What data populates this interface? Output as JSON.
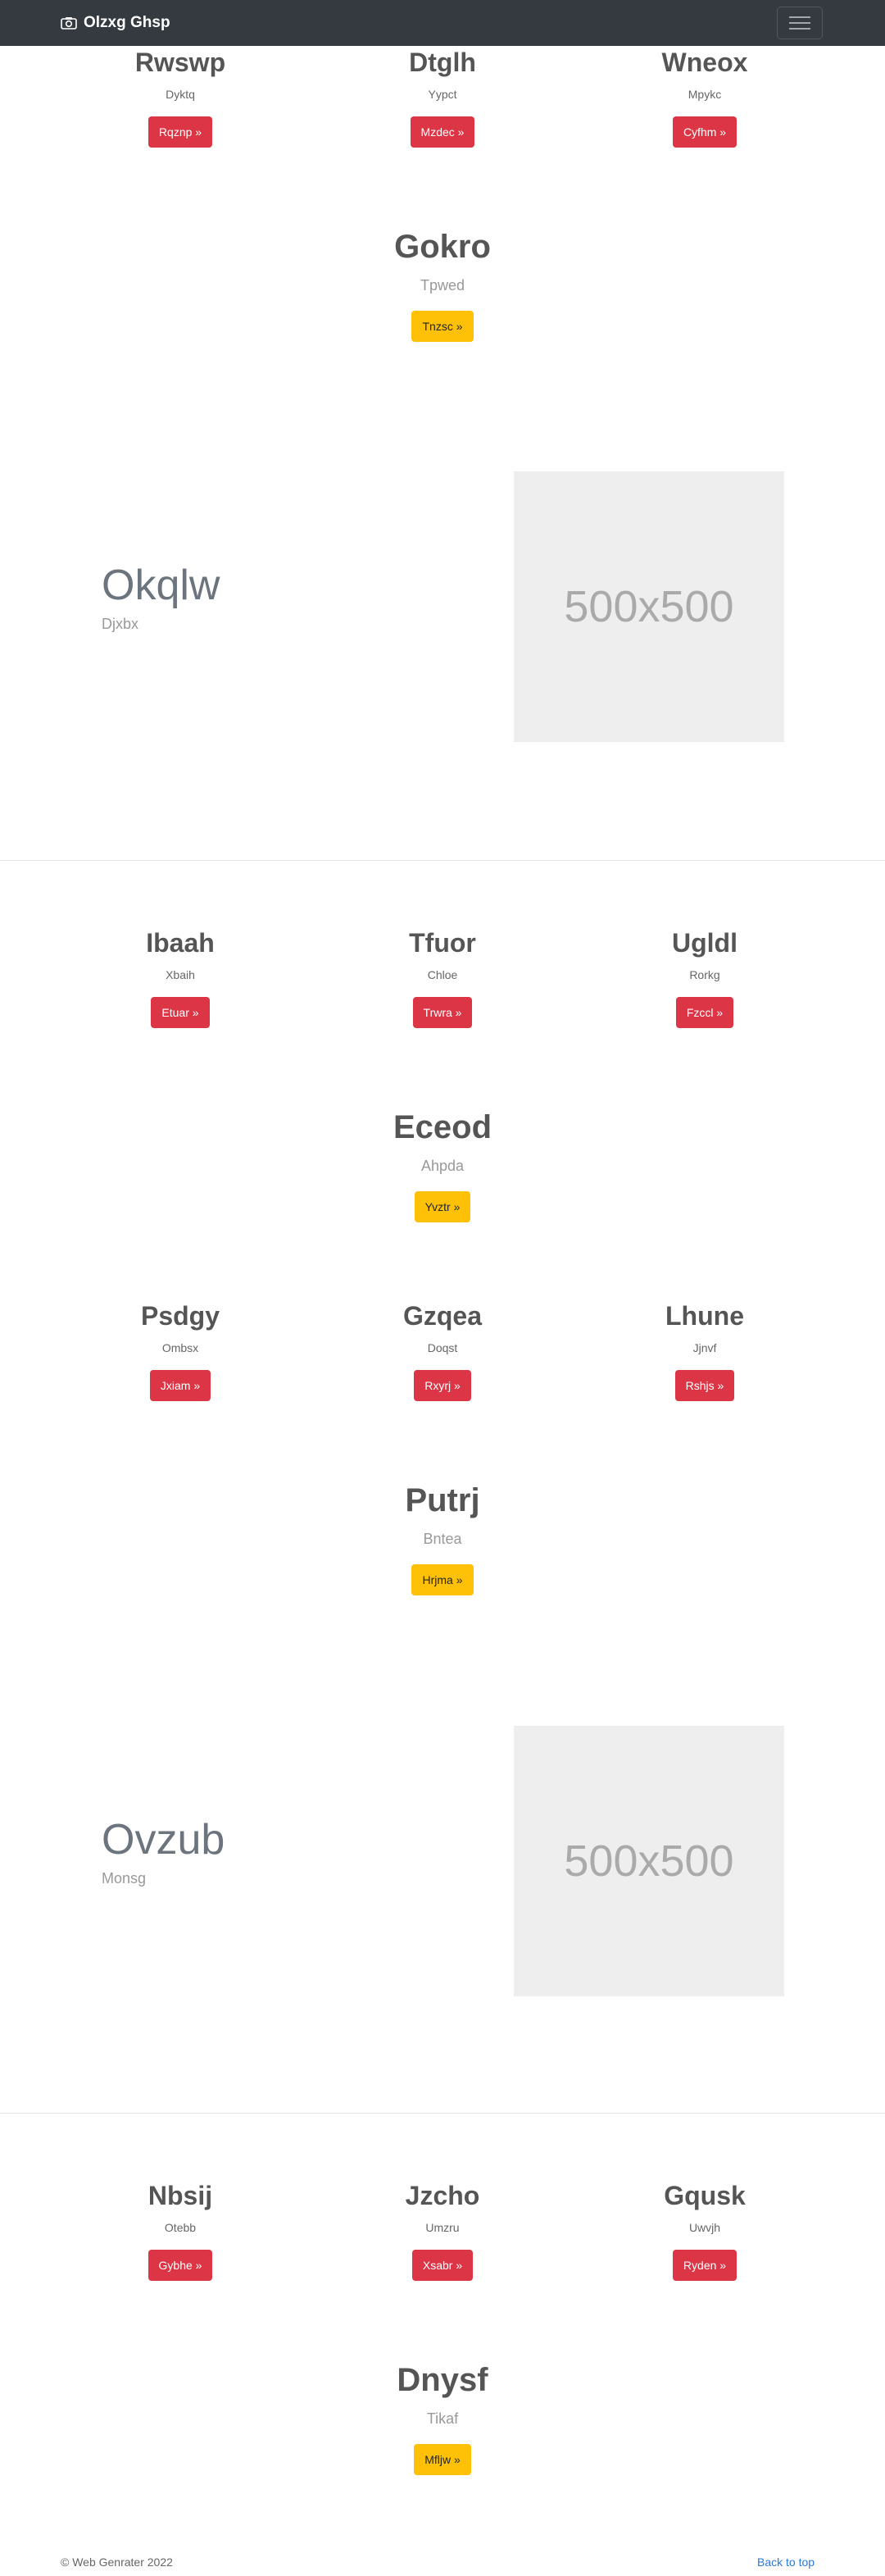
{
  "navbar": {
    "brand": "Olzxg Ghsp",
    "brand_icon": "camera-icon",
    "toggle_icon": "hamburger-icon"
  },
  "row1": [
    {
      "title": "Rwswp",
      "subtitle": "Dyktq",
      "button": "Rqznp »"
    },
    {
      "title": "Dtglh",
      "subtitle": "Yypct",
      "button": "Mzdec »"
    },
    {
      "title": "Wneox",
      "subtitle": "Mpykc",
      "button": "Cyfhm »"
    }
  ],
  "center1": {
    "title": "Gokro",
    "subtitle": "Tpwed",
    "button": "Tnzsc »"
  },
  "feature1": {
    "title": "Okqlw",
    "subtitle": "Djxbx",
    "image_label": "500x500"
  },
  "row2": [
    {
      "title": "Ibaah",
      "subtitle": "Xbaih",
      "button": "Etuar »"
    },
    {
      "title": "Tfuor",
      "subtitle": "Chloe",
      "button": "Trwra »"
    },
    {
      "title": "Ugldl",
      "subtitle": "Rorkg",
      "button": "Fzccl »"
    }
  ],
  "center2": {
    "title": "Eceod",
    "subtitle": "Ahpda",
    "button": "Yvztr »"
  },
  "row3": [
    {
      "title": "Psdgy",
      "subtitle": "Ombsx",
      "button": "Jxiam »"
    },
    {
      "title": "Gzqea",
      "subtitle": "Doqst",
      "button": "Rxyrj »"
    },
    {
      "title": "Lhune",
      "subtitle": "Jjnvf",
      "button": "Rshjs »"
    }
  ],
  "center3": {
    "title": "Putrj",
    "subtitle": "Bntea",
    "button": "Hrjma »"
  },
  "feature2": {
    "title": "Ovzub",
    "subtitle": "Monsg",
    "image_label": "500x500"
  },
  "row4": [
    {
      "title": "Nbsij",
      "subtitle": "Otebb",
      "button": "Gybhe »"
    },
    {
      "title": "Jzcho",
      "subtitle": "Umzru",
      "button": "Xsabr »"
    },
    {
      "title": "Gqusk",
      "subtitle": "Uwvjh",
      "button": "Ryden »"
    }
  ],
  "center4": {
    "title": "Dnysf",
    "subtitle": "Tikaf",
    "button": "Mfljw »"
  },
  "footer": {
    "copyright": "© Web Genrater 2022",
    "back_to_top": "Back to top"
  },
  "colors": {
    "navbar": "#343a40",
    "primary_button": "#dc3545",
    "secondary_button": "#ffc107",
    "link": "#2a78d6"
  }
}
